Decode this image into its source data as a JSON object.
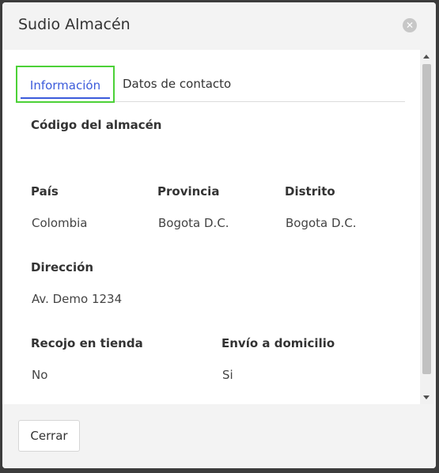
{
  "modal": {
    "title": "Sudio Almacén",
    "close_icon": "close-circle-icon"
  },
  "tabs": [
    {
      "label": "Información",
      "active": true
    },
    {
      "label": "Datos de contacto",
      "active": false
    }
  ],
  "form": {
    "codigo": {
      "label": "Código del almacén",
      "value": ""
    },
    "pais": {
      "label": "País",
      "value": "Colombia"
    },
    "provincia": {
      "label": "Provincia",
      "value": "Bogota D.C."
    },
    "distrito": {
      "label": "Distrito",
      "value": "Bogota D.C."
    },
    "direccion": {
      "label": "Dirección",
      "value": "Av. Demo 1234"
    },
    "recojo": {
      "label": "Recojo en tienda",
      "value": "No"
    },
    "envio": {
      "label": "Envío a domicilio",
      "value": "Si"
    }
  },
  "footer": {
    "close_label": "Cerrar"
  },
  "colors": {
    "accent": "#3b5bdb",
    "highlight": "#4cd137"
  }
}
